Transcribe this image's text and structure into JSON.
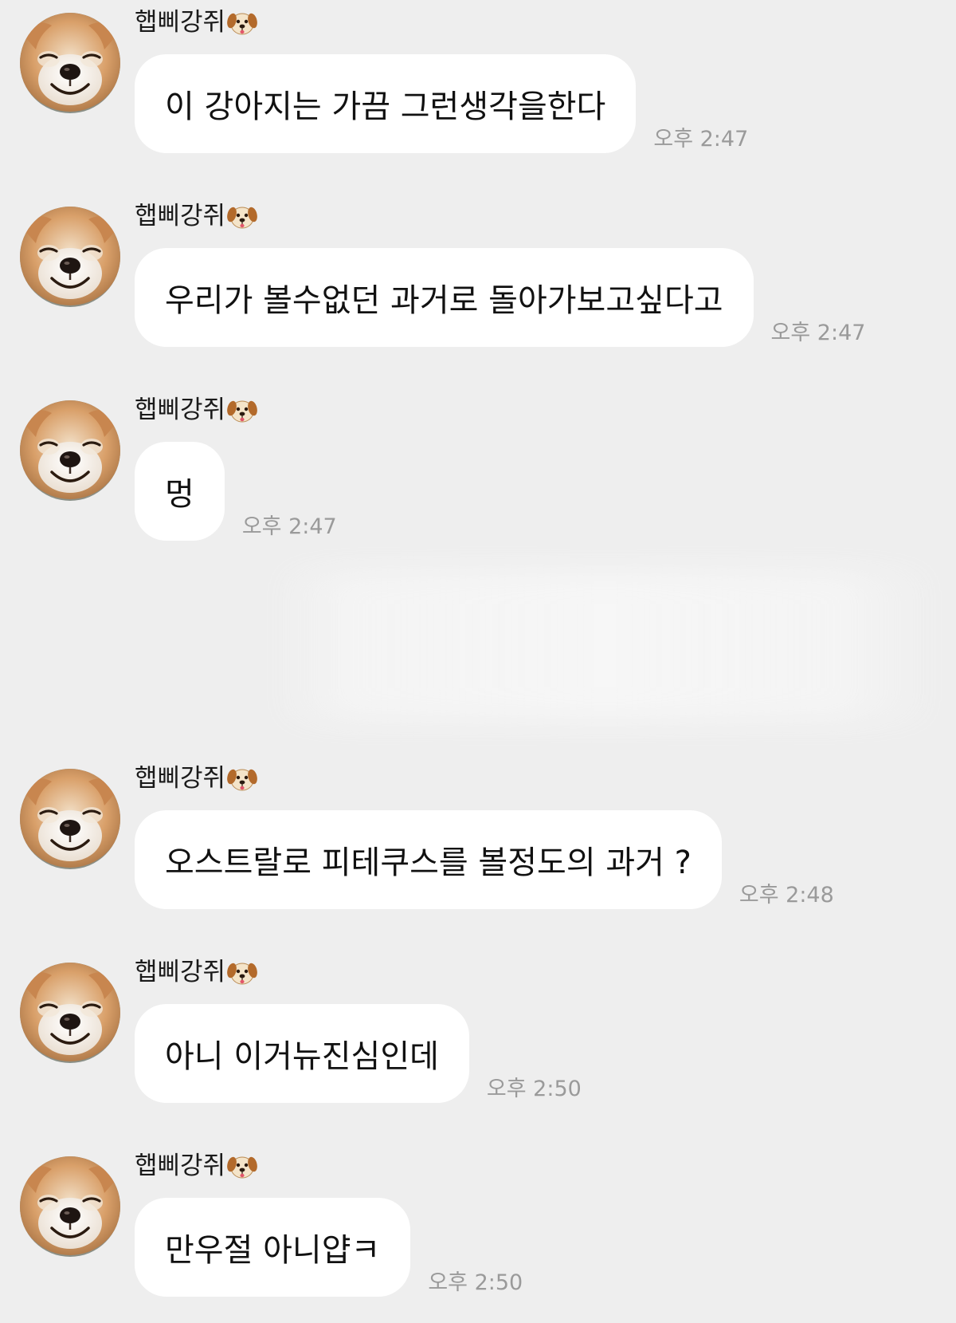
{
  "chat": {
    "messages": [
      {
        "sender": "햅삐강쥐",
        "text": "이 강아지는 가끔 그런생각을한다",
        "time": "오후 2:47"
      },
      {
        "sender": "햅삐강쥐",
        "text": "우리가 볼수없던 과거로 돌아가보고싶다고",
        "time": "오후 2:47"
      },
      {
        "sender": "햅삐강쥐",
        "text": "멍",
        "time": "오후 2:47"
      },
      {
        "sender": "햅삐강쥐",
        "text": "오스트랄로 피테쿠스를 볼정도의 과거 ?",
        "time": "오후 2:48"
      },
      {
        "sender": "햅삐강쥐",
        "text": "아니 이거뉴진심인데",
        "time": "오후 2:50"
      },
      {
        "sender": "햅삐강쥐",
        "text": "만우절 아니얍ㅋ",
        "time": "오후 2:50"
      }
    ],
    "icons": {
      "avatar": "shiba-dog-avatar",
      "sender_badge": "dog-face-emoji-icon"
    },
    "colors": {
      "background": "#eeeeee",
      "bubble": "#ffffff",
      "time_text": "#9a9a9a"
    }
  }
}
